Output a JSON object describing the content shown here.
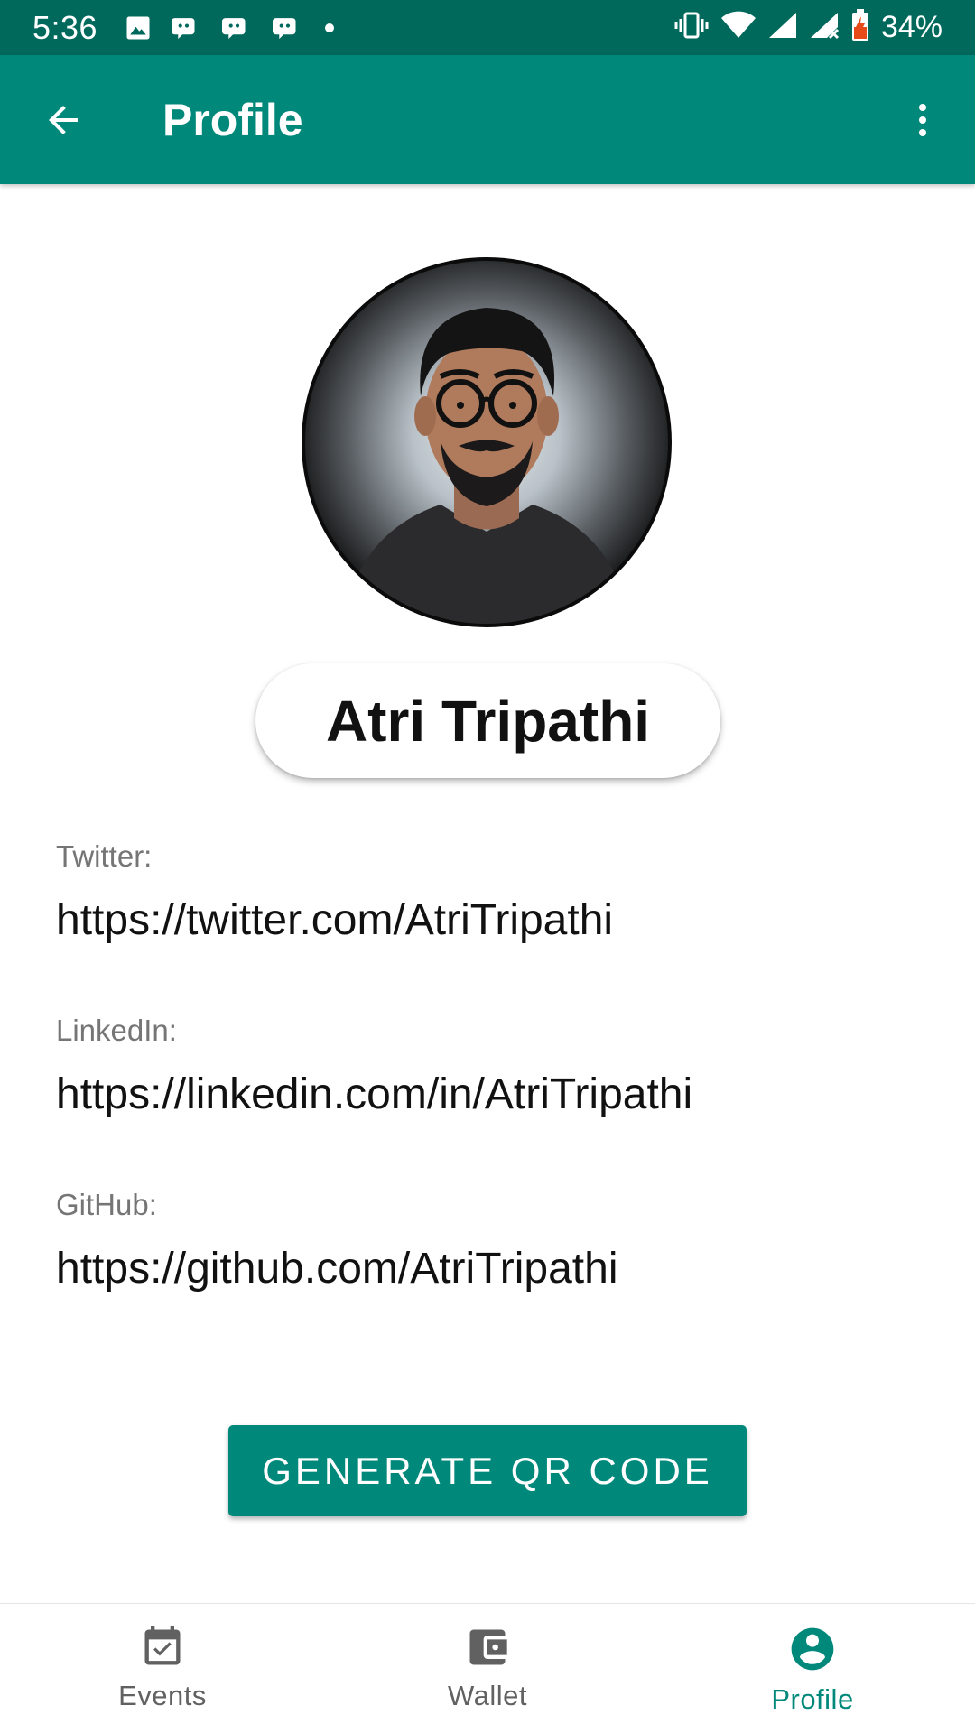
{
  "status_bar": {
    "time": "5:36",
    "battery_percent": "34%",
    "notification_icons": [
      "image-icon",
      "discord-icon",
      "discord-icon",
      "discord-icon",
      "dot-icon"
    ],
    "system_icons": [
      "vibrate-icon",
      "wifi-icon",
      "signal-icon",
      "signal-no-data-icon",
      "battery-charging-icon"
    ]
  },
  "app_bar": {
    "title": "Profile",
    "back_icon": "arrow-back-icon",
    "menu_icon": "more-vert-icon"
  },
  "profile": {
    "name": "Atri Tripathi",
    "links": [
      {
        "label": "Twitter:",
        "value": "https://twitter.com/AtriTripathi"
      },
      {
        "label": "LinkedIn:",
        "value": "https://linkedin.com/in/AtriTripathi"
      },
      {
        "label": "GitHub:",
        "value": "https://github.com/AtriTripathi"
      }
    ]
  },
  "actions": {
    "generate_qr_label": "GENERATE QR CODE"
  },
  "bottom_nav": {
    "items": [
      {
        "label": "Events",
        "icon": "calendar-check-icon",
        "active": false
      },
      {
        "label": "Wallet",
        "icon": "wallet-icon",
        "active": false
      },
      {
        "label": "Profile",
        "icon": "account-circle-icon",
        "active": true
      }
    ]
  },
  "colors": {
    "status_bar": "#00695c",
    "primary": "#00897b",
    "inactive": "#616161"
  }
}
